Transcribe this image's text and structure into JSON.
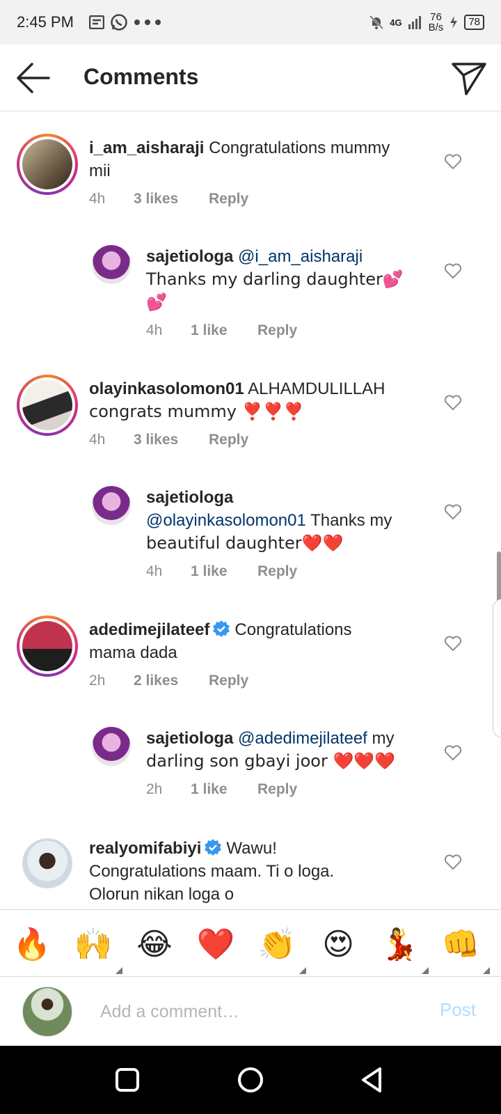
{
  "status_bar": {
    "time": "2:45 PM",
    "network": "4G",
    "speed_value": "76",
    "speed_unit": "B/s",
    "battery": "78"
  },
  "header": {
    "title": "Comments",
    "back_icon": "arrow-left-icon",
    "send_icon": "paper-plane-icon"
  },
  "comments": [
    {
      "username": "i_am_aisharaji",
      "line1": "Congratulations mummy",
      "line2": "mii",
      "time": "4h",
      "likes": "3 likes",
      "reply": "Reply",
      "replies": [
        {
          "username": "sajetiologa",
          "mention": "@i_am_aisharaji",
          "text": "Thanks my darling daughter💕",
          "text2": "💕",
          "time": "4h",
          "likes": "1 like",
          "reply": "Reply"
        }
      ]
    },
    {
      "username": "olayinkasolomon01",
      "line1": "ALHAMDULILLAH",
      "line2": "congrats mummy ❣️❣️❣️",
      "time": "4h",
      "likes": "3 likes",
      "reply": "Reply",
      "replies": [
        {
          "username": "sajetiologa",
          "mention": "@olayinkasolomon01",
          "text": "Thanks my",
          "text2": "beautiful daughter❤️❤️",
          "time": "4h",
          "likes": "1 like",
          "reply": "Reply"
        }
      ]
    },
    {
      "username": "adedimejilateef",
      "verified": true,
      "line1": "Congratulations",
      "line2": "mama dada",
      "time": "2h",
      "likes": "2 likes",
      "reply": "Reply",
      "replies": [
        {
          "username": "sajetiologa",
          "mention": "@adedimejilateef",
          "text": "my",
          "text2": "darling son gbayi joor ❤️❤️❤️",
          "time": "2h",
          "likes": "1 like",
          "reply": "Reply"
        }
      ]
    },
    {
      "username": "realyomifabiyi",
      "verified": true,
      "line1": "Wawu!",
      "line2": "Congratulations maam. Ti o loga.",
      "line3": "Olorun nikan loga o"
    }
  ],
  "emoji_bar": [
    "🔥",
    "🙌",
    "😂",
    "❤️",
    "👏",
    "😍",
    "💃",
    "👊"
  ],
  "composer": {
    "placeholder": "Add a comment…",
    "post_label": "Post"
  },
  "colors": {
    "link": "#003569",
    "muted": "#8e8e8e",
    "post_disabled": "#b3dbff",
    "verified": "#3897f0"
  }
}
